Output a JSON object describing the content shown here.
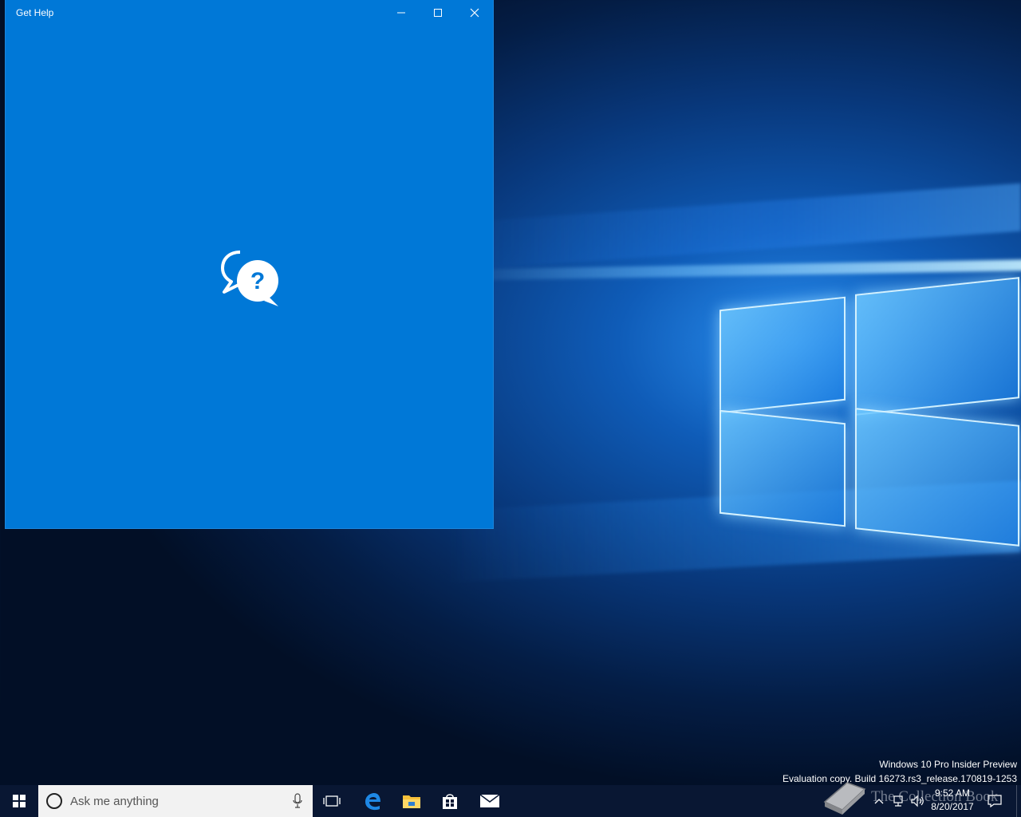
{
  "window": {
    "title": "Get Help",
    "icon": "help-chat-bubbles-icon",
    "background": "#0078d7",
    "controls": [
      "minimize-icon",
      "maximize-icon",
      "close-icon"
    ]
  },
  "desktop": {
    "watermark_line1": "Windows 10 Pro Insider Preview",
    "watermark_line2": "Evaluation copy. Build 16273.rs3_release.170819-1253"
  },
  "taskbar": {
    "search_placeholder": "Ask me anything",
    "pinned": [
      "task-view-icon",
      "edge-icon",
      "file-explorer-icon",
      "store-icon",
      "mail-icon"
    ],
    "clock_time": "9:52 AM",
    "clock_date": "8/20/2017"
  },
  "overlay": {
    "brand_text": "The Collection Book"
  }
}
